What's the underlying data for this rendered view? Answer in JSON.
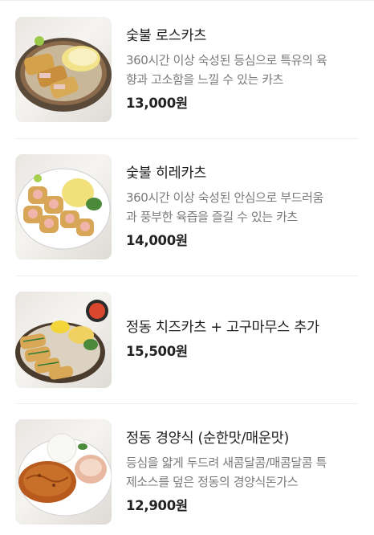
{
  "menu": {
    "items": [
      {
        "name": "숯불 로스카츠",
        "description_lines": [
          "360시간 이상 숙성된 등심으로 특유의 육",
          "향과 고소함을 느낄 수 있는 카츠"
        ],
        "price": "13,000원"
      },
      {
        "name": "숯불 히레카츠",
        "description_lines": [
          "360시간 이상 숙성된 안심으로 부드러움",
          "과 풍부한 육즙을 즐길 수 있는 카츠"
        ],
        "price": "14,000원"
      },
      {
        "name": "정동 치즈카츠 + 고구마무스 추가",
        "description_lines": [],
        "price": "15,500원"
      },
      {
        "name": "정동 경양식 (순한맛/매운맛)",
        "description_lines": [
          "등심을 얇게 두드려 새콤달콤/매콤달콤 특",
          "제소스를 덮은 정동의 경양식돈가스"
        ],
        "price": "12,900원"
      }
    ]
  }
}
